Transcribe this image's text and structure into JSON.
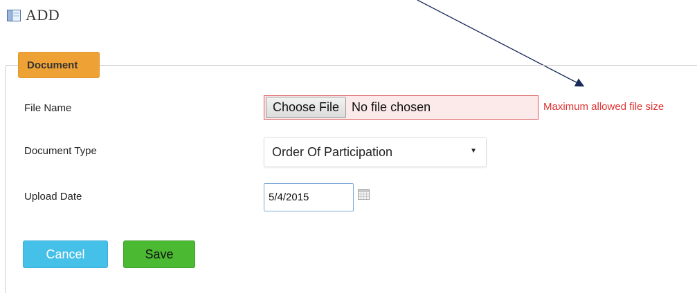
{
  "header": {
    "title": "ADD",
    "icon": "panel-icon"
  },
  "section": {
    "legend": "Document"
  },
  "form": {
    "file_name": {
      "label": "File Name",
      "button_label": "Choose File",
      "status_text": "No file chosen",
      "error_text": "Maximum allowed file size",
      "error_color": "#e23333"
    },
    "document_type": {
      "label": "Document Type",
      "selected_value": "Order Of Participation"
    },
    "upload_date": {
      "label": "Upload Date",
      "value": "5/4/2015",
      "icon": "calendar-icon"
    }
  },
  "actions": {
    "cancel_label": "Cancel",
    "save_label": "Save"
  },
  "colors": {
    "legend_bg": "#eea236",
    "cancel_bg": "#45c0e8",
    "save_bg": "#4cb933",
    "error_border": "#d85050"
  }
}
